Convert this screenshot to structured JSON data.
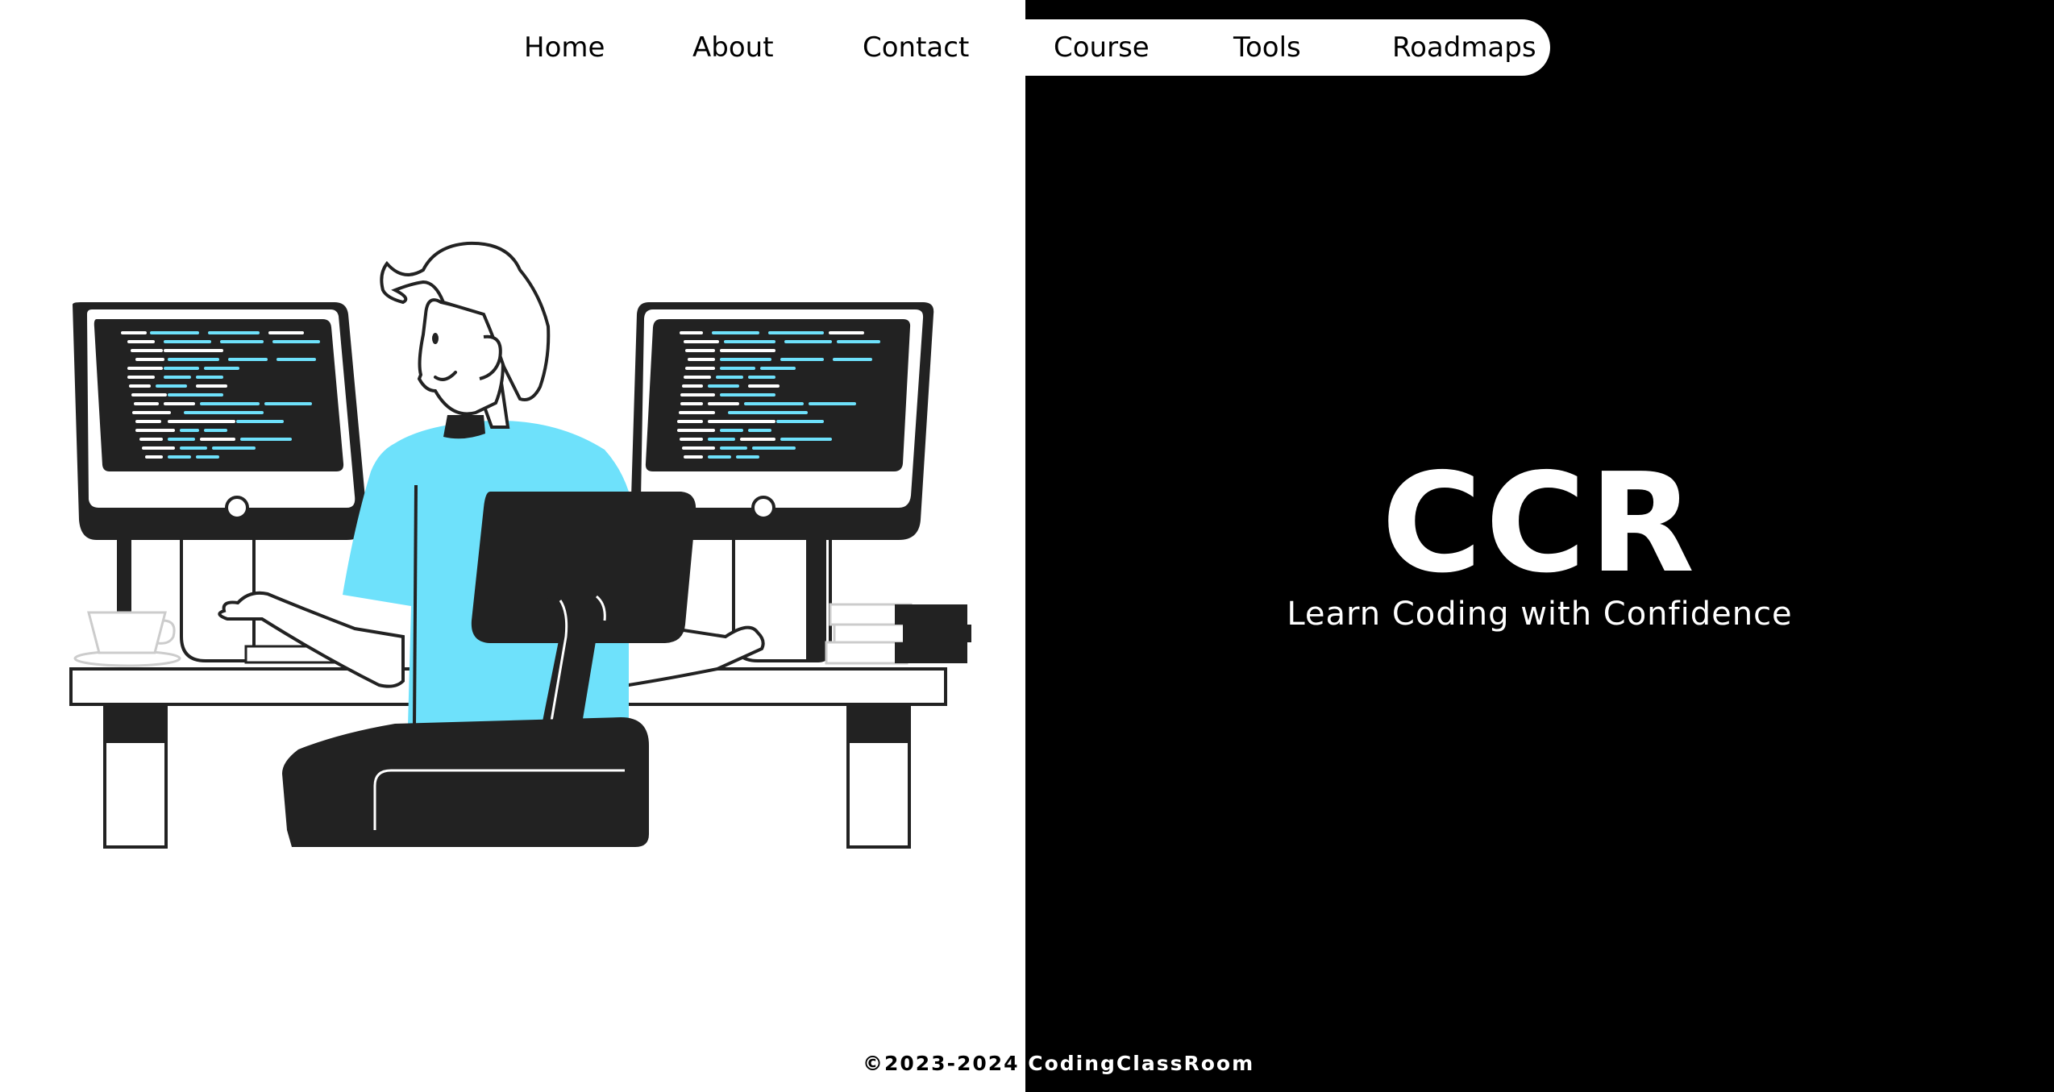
{
  "nav": {
    "items": [
      {
        "label": "Home"
      },
      {
        "label": "About"
      },
      {
        "label": "Contact"
      },
      {
        "label": "Course"
      },
      {
        "label": "Tools"
      },
      {
        "label": "Roadmaps"
      }
    ]
  },
  "hero": {
    "title": "CCR",
    "subtitle": "Learn Coding with Confidence"
  },
  "footer": {
    "text_left": "©2023-2024 ",
    "text_right": "CodingClassRoom"
  },
  "illustration": {
    "icon": "developer-at-desk-illustration"
  },
  "colors": {
    "accent": "#6ee1fb",
    "dark": "#222222",
    "left_background": "#ffffff",
    "right_background": "#000000"
  }
}
